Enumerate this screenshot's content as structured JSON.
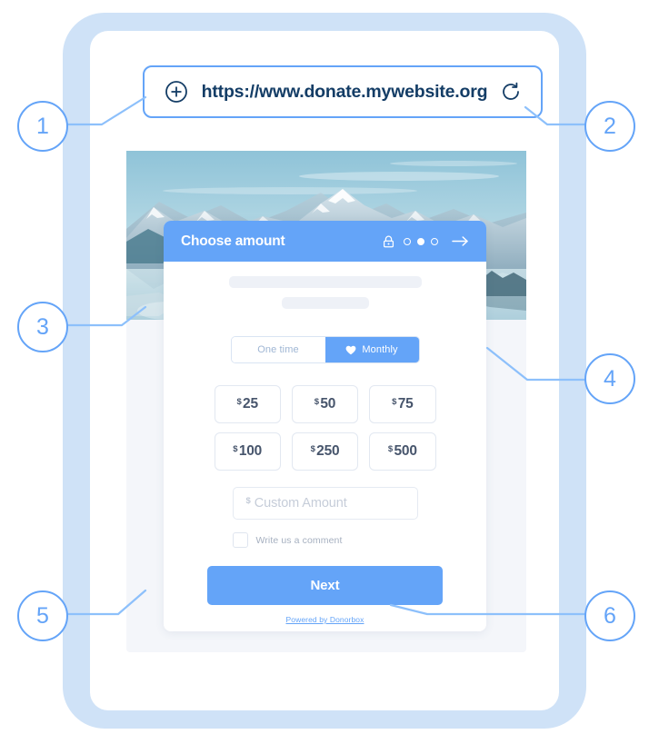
{
  "browser": {
    "url": "https://www.donate.mywebsite.org",
    "plus_icon": "plus-circle-icon",
    "reload_icon": "reload-icon"
  },
  "hero": {
    "alt": "mountain lake landscape"
  },
  "card": {
    "header": {
      "title": "Choose amount",
      "lock_icon": "lock-icon",
      "arrow_icon": "arrow-right-icon",
      "steps": [
        {
          "state": "empty"
        },
        {
          "state": "filled"
        },
        {
          "state": "empty"
        }
      ]
    },
    "frequency": {
      "one_time_label": "One time",
      "monthly_label": "Monthly",
      "monthly_icon": "heart-icon",
      "selected": "Monthly"
    },
    "amounts": [
      {
        "currency": "$",
        "value": "25"
      },
      {
        "currency": "$",
        "value": "50"
      },
      {
        "currency": "$",
        "value": "75"
      },
      {
        "currency": "$",
        "value": "100"
      },
      {
        "currency": "$",
        "value": "250"
      },
      {
        "currency": "$",
        "value": "500"
      }
    ],
    "custom_amount": {
      "currency": "$",
      "placeholder": "Custom Amount",
      "value": ""
    },
    "comment": {
      "label": "Write us a comment",
      "checked": false
    },
    "next_label": "Next",
    "powered_by": "Powered by Donorbox"
  },
  "markers": [
    {
      "number": "1"
    },
    {
      "number": "2"
    },
    {
      "number": "3"
    },
    {
      "number": "4"
    },
    {
      "number": "5"
    },
    {
      "number": "6"
    }
  ],
  "colors": {
    "accent": "#64a4f8",
    "frame": "#cfe2f7",
    "page_backdrop": "#f4f6fa",
    "amount_text": "#47556c",
    "url_text": "#143d66"
  }
}
